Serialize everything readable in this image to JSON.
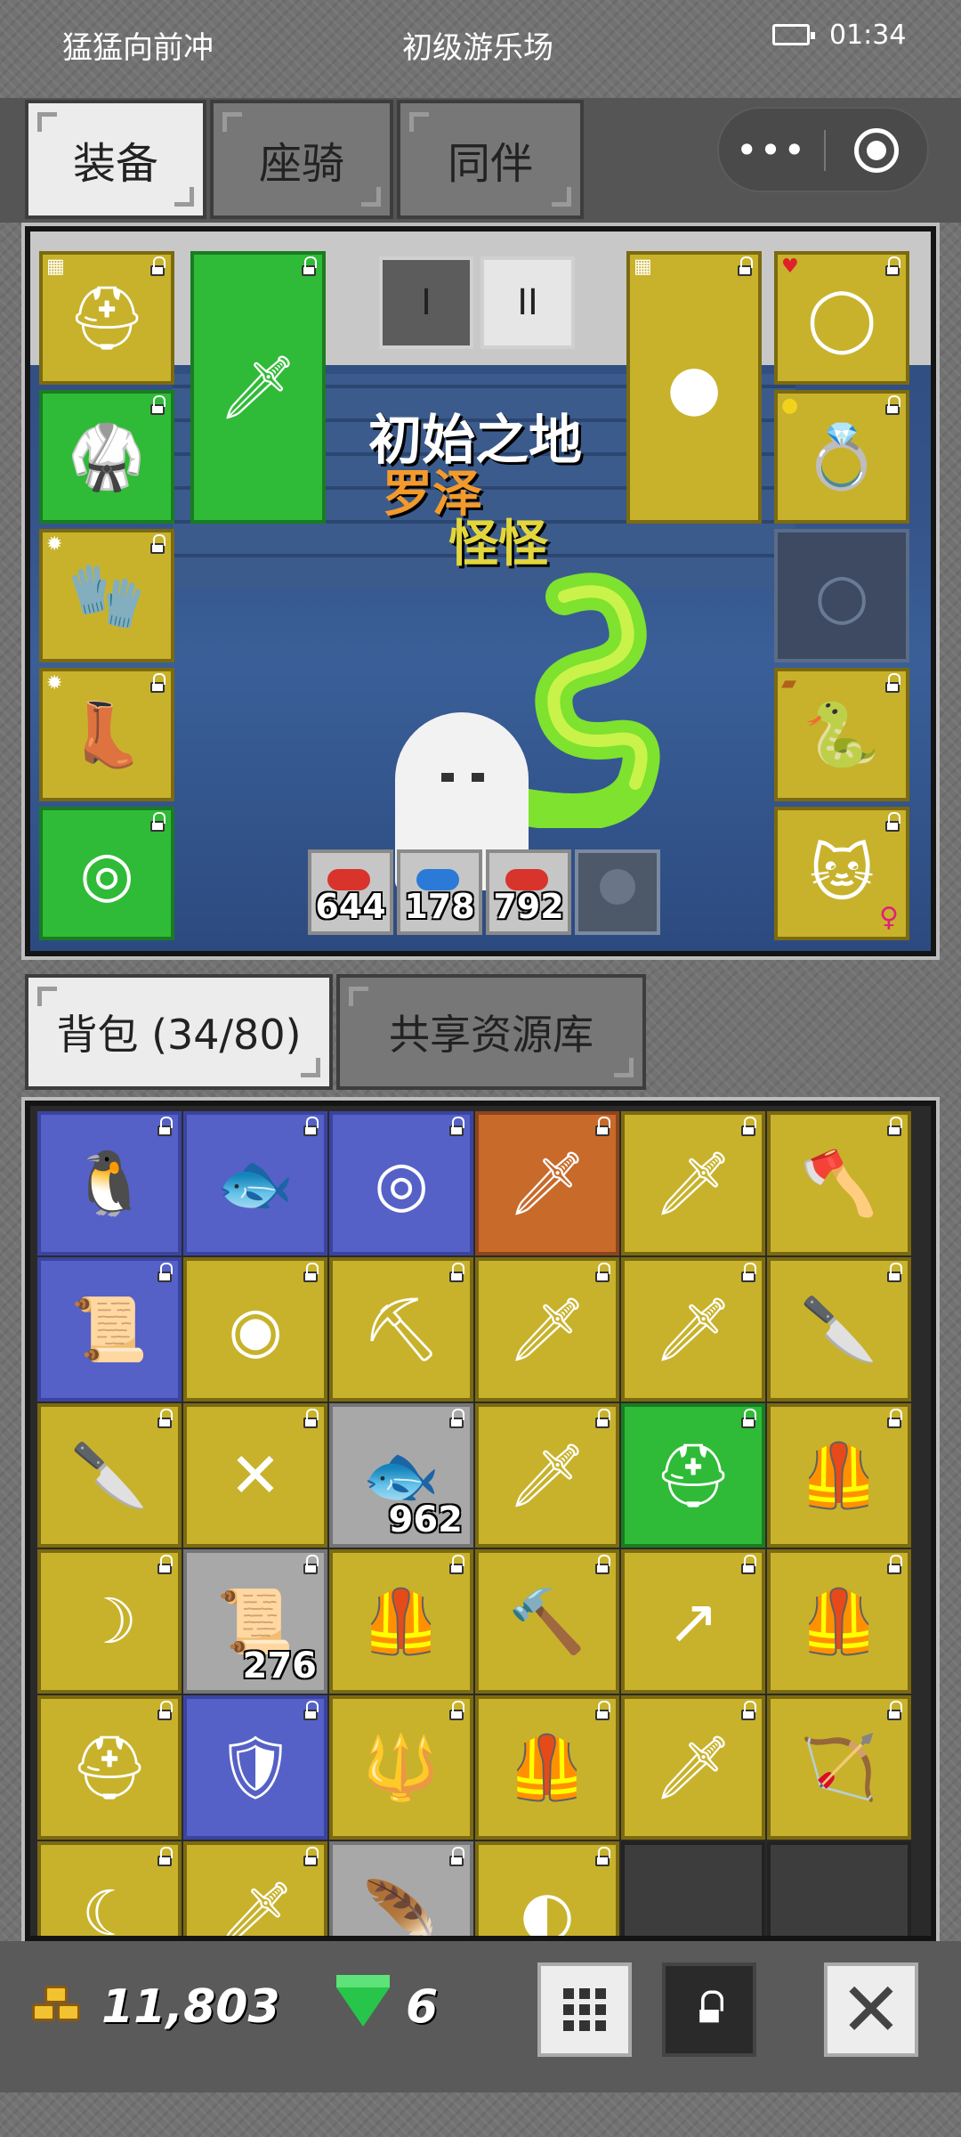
{
  "status_bar": {
    "left": "猛猛向前冲",
    "center": "初级游乐场",
    "time": "01:34"
  },
  "top_tabs": [
    {
      "label": "装备",
      "active": true
    },
    {
      "label": "座骑",
      "active": false
    },
    {
      "label": "同伴",
      "active": false
    }
  ],
  "capsule": {
    "more_icon": "ellipsis-icon",
    "target_icon": "target-icon"
  },
  "equip": {
    "map_name": "初始之地",
    "hero_name": "罗泽",
    "pet_name": "怪怪",
    "page_buttons": [
      "I",
      "II"
    ],
    "stats": [
      "644",
      "178",
      "792"
    ],
    "left_slots": [
      "helmet-icon",
      "chest-armor-icon",
      "gloves-icon",
      "boots-icon",
      "belt-icon"
    ],
    "weapon_slot": "sword-icon",
    "offhand_slot": "shield-icon",
    "right_slots": [
      "necklace-icon",
      "ring-icon",
      "empty-ring-slot-icon",
      "snake-pet-icon",
      "cat-companion-icon"
    ]
  },
  "bag_tabs": [
    {
      "label": "背包 (34/80)",
      "active": true
    },
    {
      "label": "共享资源库",
      "active": false
    }
  ],
  "bag": {
    "items": [
      {
        "icon": "penguin-card-icon",
        "color": "blue",
        "count": ""
      },
      {
        "icon": "fish-card-icon",
        "color": "blue",
        "count": ""
      },
      {
        "icon": "amulet-icon",
        "color": "blue",
        "count": ""
      },
      {
        "icon": "gold-dagger-icon",
        "color": "orange",
        "count": ""
      },
      {
        "icon": "sword-icon",
        "color": "yellow",
        "count": ""
      },
      {
        "icon": "axe-icon",
        "color": "yellow",
        "count": ""
      },
      {
        "icon": "scroll-icon",
        "color": "blue",
        "count": ""
      },
      {
        "icon": "belt-icon",
        "color": "yellow",
        "count": ""
      },
      {
        "icon": "pickaxe-icon",
        "color": "yellow",
        "count": ""
      },
      {
        "icon": "sword-icon",
        "color": "yellow",
        "count": ""
      },
      {
        "icon": "blue-sword-icon",
        "color": "yellow",
        "count": ""
      },
      {
        "icon": "dagger-icon",
        "color": "yellow",
        "count": ""
      },
      {
        "icon": "dagger-icon",
        "color": "yellow",
        "count": ""
      },
      {
        "icon": "crossbow-icon",
        "color": "yellow",
        "count": ""
      },
      {
        "icon": "fish-icon",
        "color": "gray",
        "count": "962"
      },
      {
        "icon": "sword-icon",
        "color": "yellow",
        "count": ""
      },
      {
        "icon": "helmet-icon",
        "color": "green",
        "count": ""
      },
      {
        "icon": "armor-icon",
        "color": "yellow",
        "count": ""
      },
      {
        "icon": "scythe-icon",
        "color": "yellow",
        "count": ""
      },
      {
        "icon": "scroll-icon",
        "color": "gray",
        "count": "276"
      },
      {
        "icon": "armor-icon",
        "color": "yellow",
        "count": ""
      },
      {
        "icon": "hammer-icon",
        "color": "yellow",
        "count": ""
      },
      {
        "icon": "spear-icon",
        "color": "yellow",
        "count": ""
      },
      {
        "icon": "armor-icon",
        "color": "yellow",
        "count": ""
      },
      {
        "icon": "helmet-icon",
        "color": "yellow",
        "count": ""
      },
      {
        "icon": "shield-icon",
        "color": "blue",
        "count": ""
      },
      {
        "icon": "trident-icon",
        "color": "yellow",
        "count": ""
      },
      {
        "icon": "armor-icon",
        "color": "yellow",
        "count": ""
      },
      {
        "icon": "sword-icon",
        "color": "yellow",
        "count": ""
      },
      {
        "icon": "bow-icon",
        "color": "yellow",
        "count": ""
      },
      {
        "icon": "sickle-icon",
        "color": "yellow",
        "count": ""
      },
      {
        "icon": "blue-sword-icon",
        "color": "yellow",
        "count": ""
      },
      {
        "icon": "feather-icon",
        "color": "gray",
        "count": ""
      },
      {
        "icon": "round-helmet-icon",
        "color": "yellow",
        "count": ""
      },
      {
        "icon": "",
        "color": "empty",
        "count": ""
      },
      {
        "icon": "",
        "color": "empty",
        "count": ""
      }
    ]
  },
  "resources": {
    "gold": "11,803",
    "gems": "6"
  },
  "bottom_buttons": [
    "grid-icon",
    "lock-icon",
    "close-icon"
  ],
  "colors": {
    "yellow": "#c8b22c",
    "green": "#2fbb37",
    "blue": "#5561c7",
    "orange": "#c86a2a",
    "gray": "#a8a8a8"
  }
}
